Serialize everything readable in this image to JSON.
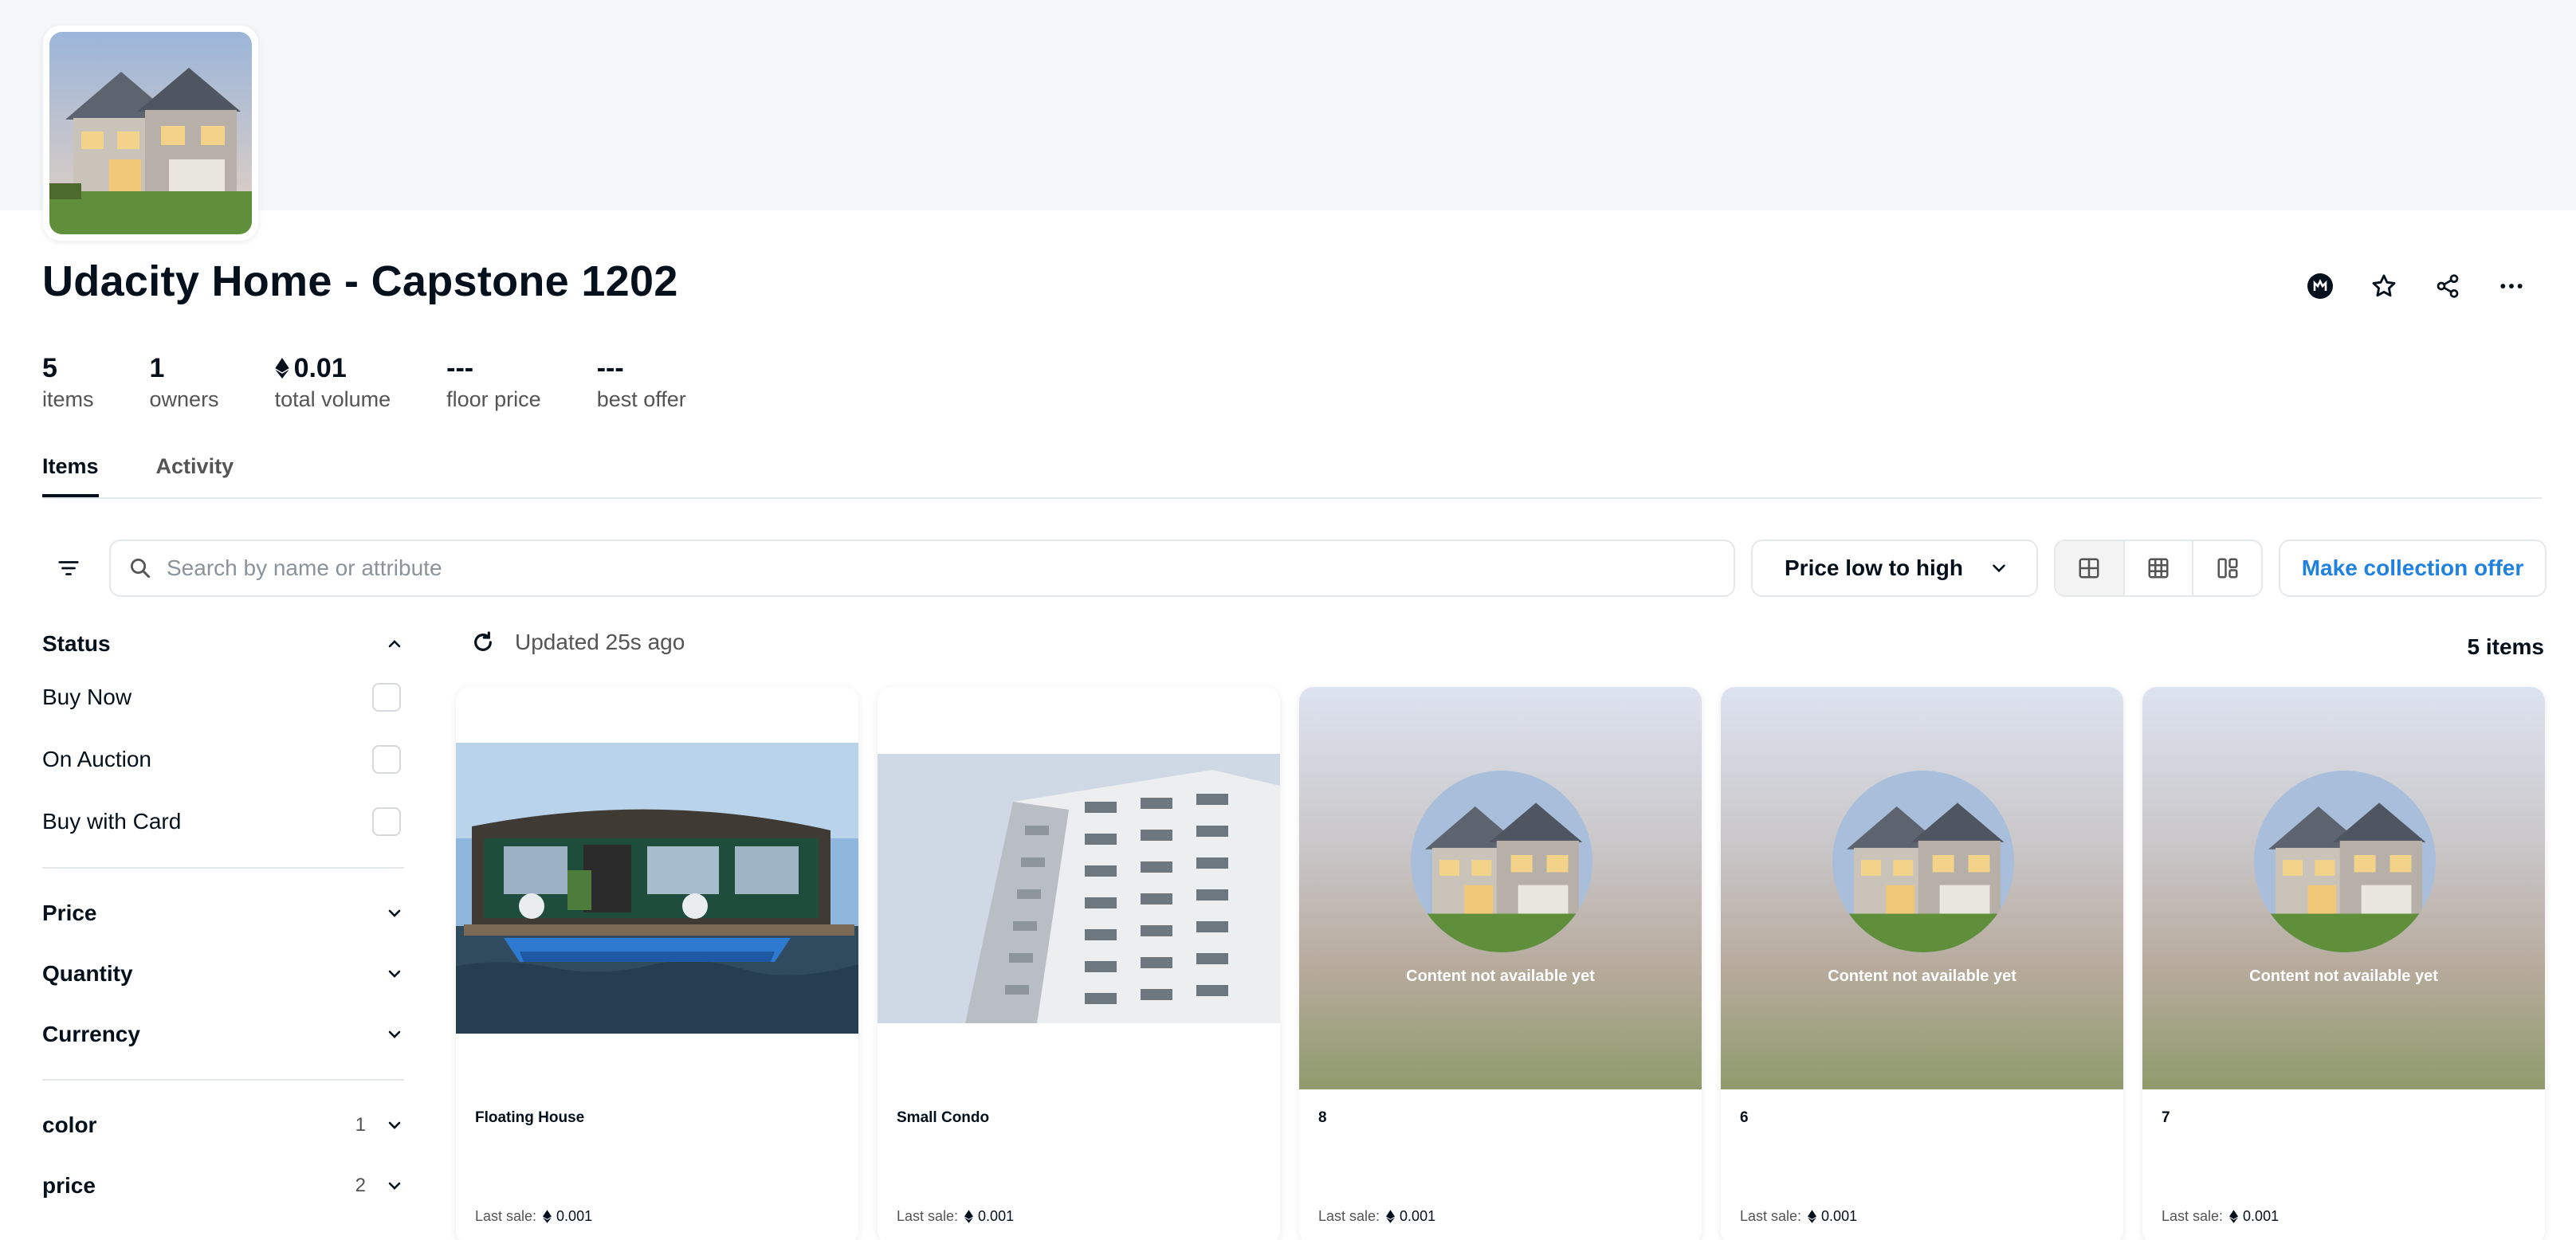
{
  "collection": {
    "title": "Udacity Home - Capstone 1202"
  },
  "stats": [
    {
      "value": "5",
      "label": "items"
    },
    {
      "value": "1",
      "label": "owners"
    },
    {
      "value": "0.01",
      "label": "total volume",
      "currency": "eth-icon"
    },
    {
      "value": "---",
      "label": "floor price"
    },
    {
      "value": "---",
      "label": "best offer"
    }
  ],
  "tabs": [
    {
      "label": "Items",
      "active": true
    },
    {
      "label": "Activity",
      "active": false
    }
  ],
  "toolbar": {
    "search_placeholder": "Search by name or attribute",
    "sort_label": "Price low to high",
    "make_offer_label": "Make collection offer"
  },
  "sidebar": {
    "status_title": "Status",
    "status_options": [
      "Buy Now",
      "On Auction",
      "Buy with Card"
    ],
    "price_title": "Price",
    "quantity_title": "Quantity",
    "currency_title": "Currency",
    "traits": [
      {
        "name": "color",
        "count": "1"
      },
      {
        "name": "price",
        "count": "2"
      }
    ]
  },
  "results": {
    "updated": "Updated 25s ago",
    "count": "5 items"
  },
  "cards": [
    {
      "name": "Floating House",
      "media": "houseboat",
      "last_sale_label": "Last sale:",
      "last_sale": "0.001"
    },
    {
      "name": "Small Condo",
      "media": "condo",
      "last_sale_label": "Last sale:",
      "last_sale": "0.001"
    },
    {
      "name": "8",
      "media": "placeholder",
      "placeholder_text": "Content not available yet",
      "last_sale_label": "Last sale:",
      "last_sale": "0.001"
    },
    {
      "name": "6",
      "media": "placeholder",
      "placeholder_text": "Content not available yet",
      "last_sale_label": "Last sale:",
      "last_sale": "0.001"
    },
    {
      "name": "7",
      "media": "placeholder",
      "placeholder_text": "Content not available yet",
      "last_sale_label": "Last sale:",
      "last_sale": "0.001"
    }
  ],
  "colors": {
    "accent": "#2081e2",
    "text": "#04111d",
    "muted": "#545454",
    "border": "#e5e8eb"
  }
}
